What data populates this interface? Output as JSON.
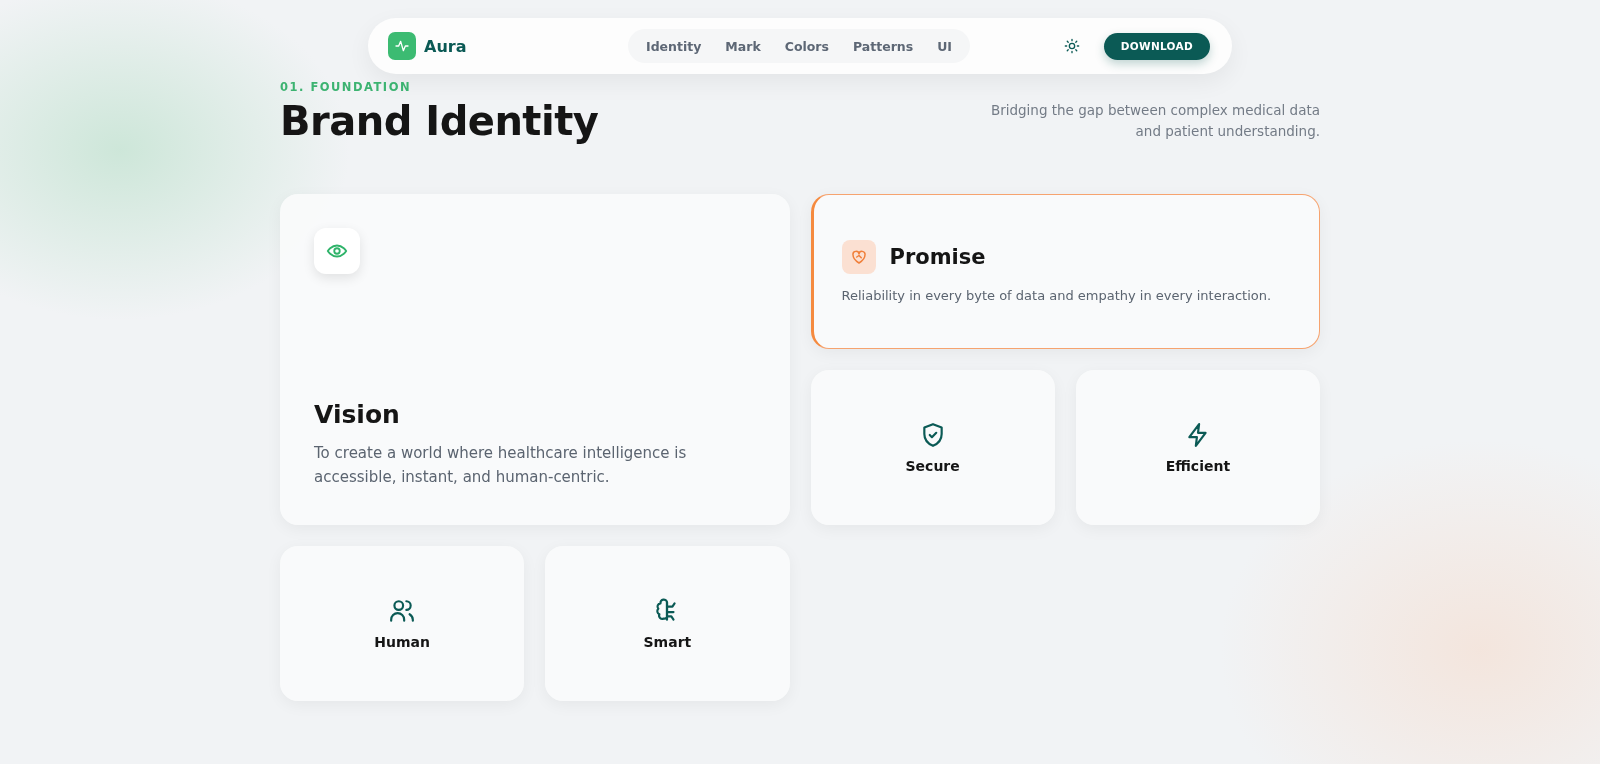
{
  "nav": {
    "brand": "Aura",
    "links": [
      "Identity",
      "Mark",
      "Colors",
      "Patterns",
      "UI"
    ],
    "download": "DOWNLOAD"
  },
  "header": {
    "eyebrow": "01. FOUNDATION",
    "title": "Brand Identity",
    "subtitle": "Bridging the gap between complex medical data and patient understanding."
  },
  "cards": [
    {
      "kind": "hero",
      "title": "Vision",
      "text": "To create a world where healthcare intelligence is accessible, instant, and human-centric."
    },
    {
      "kind": "highlight",
      "title": "Promise",
      "text": "Reliability in every byte of data and empathy in every interaction."
    },
    {
      "kind": "tile",
      "title": "Secure"
    },
    {
      "kind": "tile",
      "title": "Efficient"
    },
    {
      "kind": "tile",
      "title": "Human"
    },
    {
      "kind": "tile",
      "title": "Smart"
    }
  ]
}
